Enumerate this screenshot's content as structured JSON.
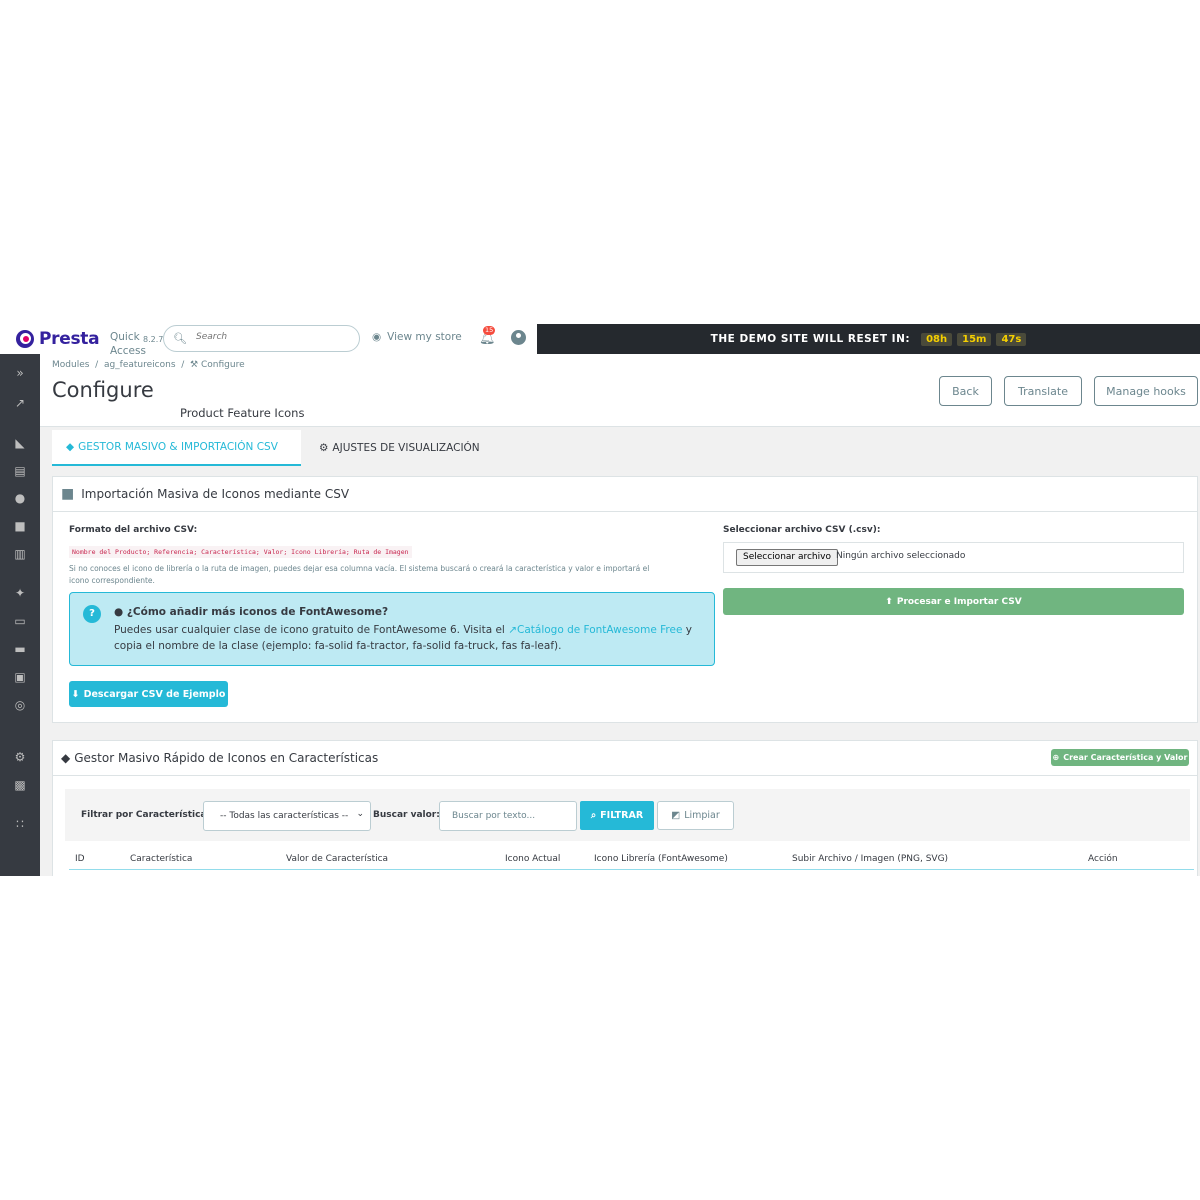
{
  "header": {
    "logo_text": "Presta",
    "quick_access": "Quick Access",
    "version": "8.2.7",
    "search_placeholder": "Search",
    "view_store": "View my store",
    "notifications_count": "15",
    "demo_label": "THE DEMO SITE WILL RESET IN:",
    "timer": [
      "08h",
      "15m",
      "47s"
    ]
  },
  "sidebar": {
    "icons": [
      "expand-icon",
      "dashboard-icon",
      "orders-icon",
      "catalog-icon",
      "customers-icon",
      "messages-icon",
      "stats-icon",
      "modules-icon",
      "design-icon",
      "shipping-icon",
      "payment-icon",
      "international-icon",
      "settings-icon",
      "advanced-icon",
      "team-icon"
    ]
  },
  "page": {
    "breadcrumb": [
      "Modules",
      "ag_featureicons",
      "Configure"
    ],
    "title": "Configure",
    "subtitle": "Product Feature Icons",
    "back": "Back",
    "translate": "Translate",
    "manage_hooks": "Manage hooks"
  },
  "tabs": [
    {
      "label": "GESTOR MASIVO & IMPORTACIÓN CSV"
    },
    {
      "label": "AJUSTES DE VISUALIZACIÓN"
    }
  ],
  "import_panel": {
    "title": "Importación Masiva de Iconos mediante CSV",
    "format_label": "Formato del archivo CSV:",
    "format_code": "Nombre del Producto; Referencia; Característica; Valor; Icono Librería; Ruta de Imagen",
    "help_text": "Si no conoces el icono de librería o la ruta de imagen, puedes dejar esa columna vacía. El sistema buscará o creará la característica y valor e importará el icono correspondiente.",
    "alert_title": "¿Cómo añadir más iconos de FontAwesome?",
    "alert_body_pre": "Puedes usar cualquier clase de icono gratuito de FontAwesome 6. Visita el ",
    "alert_link": "Catálogo de FontAwesome Free",
    "alert_body_post": " y copia el nombre de la clase (ejemplo: fa-solid fa-tractor, fa-solid fa-truck, fas fa-leaf).",
    "download_btn": "Descargar CSV de Ejemplo",
    "file_label": "Seleccionar archivo CSV (.csv):",
    "file_btn": "Seleccionar archivo",
    "file_status": "Ningún archivo seleccionado",
    "process_btn": "Procesar e Importar CSV"
  },
  "manager_panel": {
    "title": "Gestor Masivo Rápido de Iconos en Características",
    "create_btn": "Crear Característica y Valor",
    "filter_label": "Filtrar por Característica:",
    "filter_value": "-- Todas las características --",
    "search_label": "Buscar valor:",
    "search_placeholder": "Buscar por texto...",
    "filter_btn": "FILTRAR",
    "clear_btn": "Limpiar",
    "columns": [
      "ID",
      "Característica",
      "Valor de Característica",
      "Icono Actual",
      "Icono Librería (FontAwesome)",
      "Subir Archivo / Imagen (PNG, SVG)",
      "Acción"
    ]
  },
  "colors": {
    "primary": "#25b9d7",
    "success": "#70b580",
    "sidebar": "#363a41",
    "brand": "#34219e"
  }
}
